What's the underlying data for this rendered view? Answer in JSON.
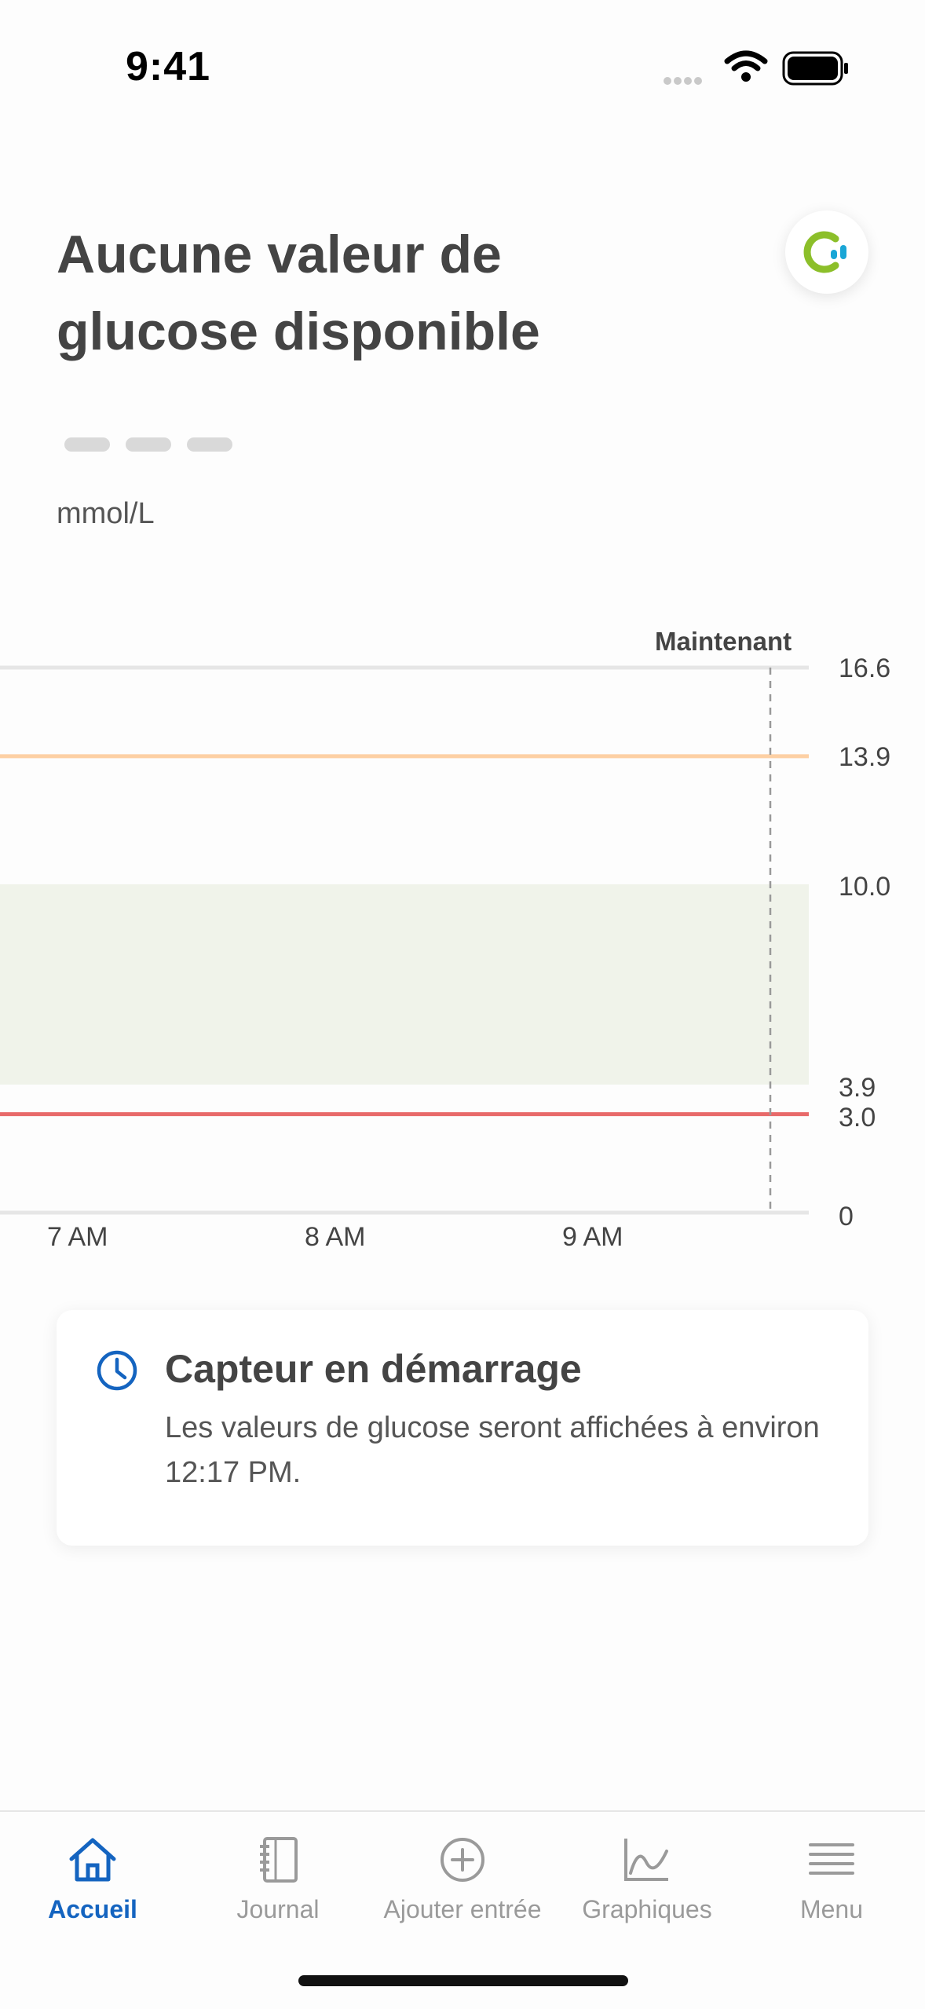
{
  "status_bar": {
    "time": "9:41"
  },
  "header": {
    "title": "Aucune valeur de glucose disponible",
    "unit": "mmol/L"
  },
  "chart_data": {
    "type": "line",
    "now_label": "Maintenant",
    "y_ticks": [
      "16.6",
      "13.9",
      "10.0",
      "3.9",
      "3.0",
      "0"
    ],
    "x_ticks": [
      "7 AM",
      "8 AM",
      "9 AM"
    ],
    "ylim": [
      0,
      16.6
    ],
    "target_range": [
      3.9,
      10.0
    ],
    "high_threshold": 13.9,
    "low_threshold": 3.0,
    "series": [],
    "colors": {
      "target_band": "#f0f3ea",
      "high_line": "#fdd0a4",
      "low_line": "#e86a6a",
      "now_line": "#999999"
    }
  },
  "status_card": {
    "title": "Capteur en démarrage",
    "message": "Les valeurs de glucose seront affichées à environ 12:17 PM.",
    "icon": "clock-icon"
  },
  "tabbar": {
    "items": [
      {
        "label": "Accueil",
        "icon": "home-icon",
        "active": true
      },
      {
        "label": "Journal",
        "icon": "journal-icon",
        "active": false
      },
      {
        "label": "Ajouter entrée",
        "icon": "add-circle-icon",
        "active": false
      },
      {
        "label": "Graphiques",
        "icon": "chart-icon",
        "active": false
      },
      {
        "label": "Menu",
        "icon": "menu-icon",
        "active": false
      }
    ]
  },
  "colors": {
    "accent": "#1464c0",
    "logo_green": "#8cbf2a",
    "logo_blue": "#1aa6d6"
  }
}
